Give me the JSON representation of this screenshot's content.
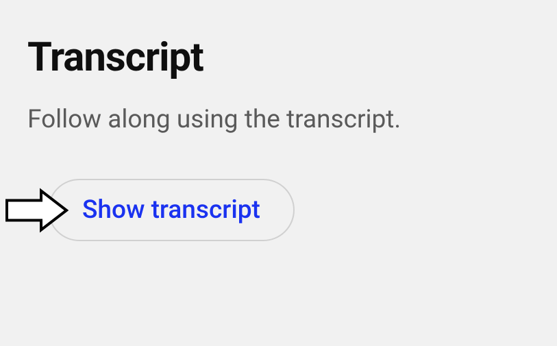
{
  "transcript": {
    "title": "Transcript",
    "description": "Follow along using the transcript.",
    "button_label": "Show transcript"
  }
}
